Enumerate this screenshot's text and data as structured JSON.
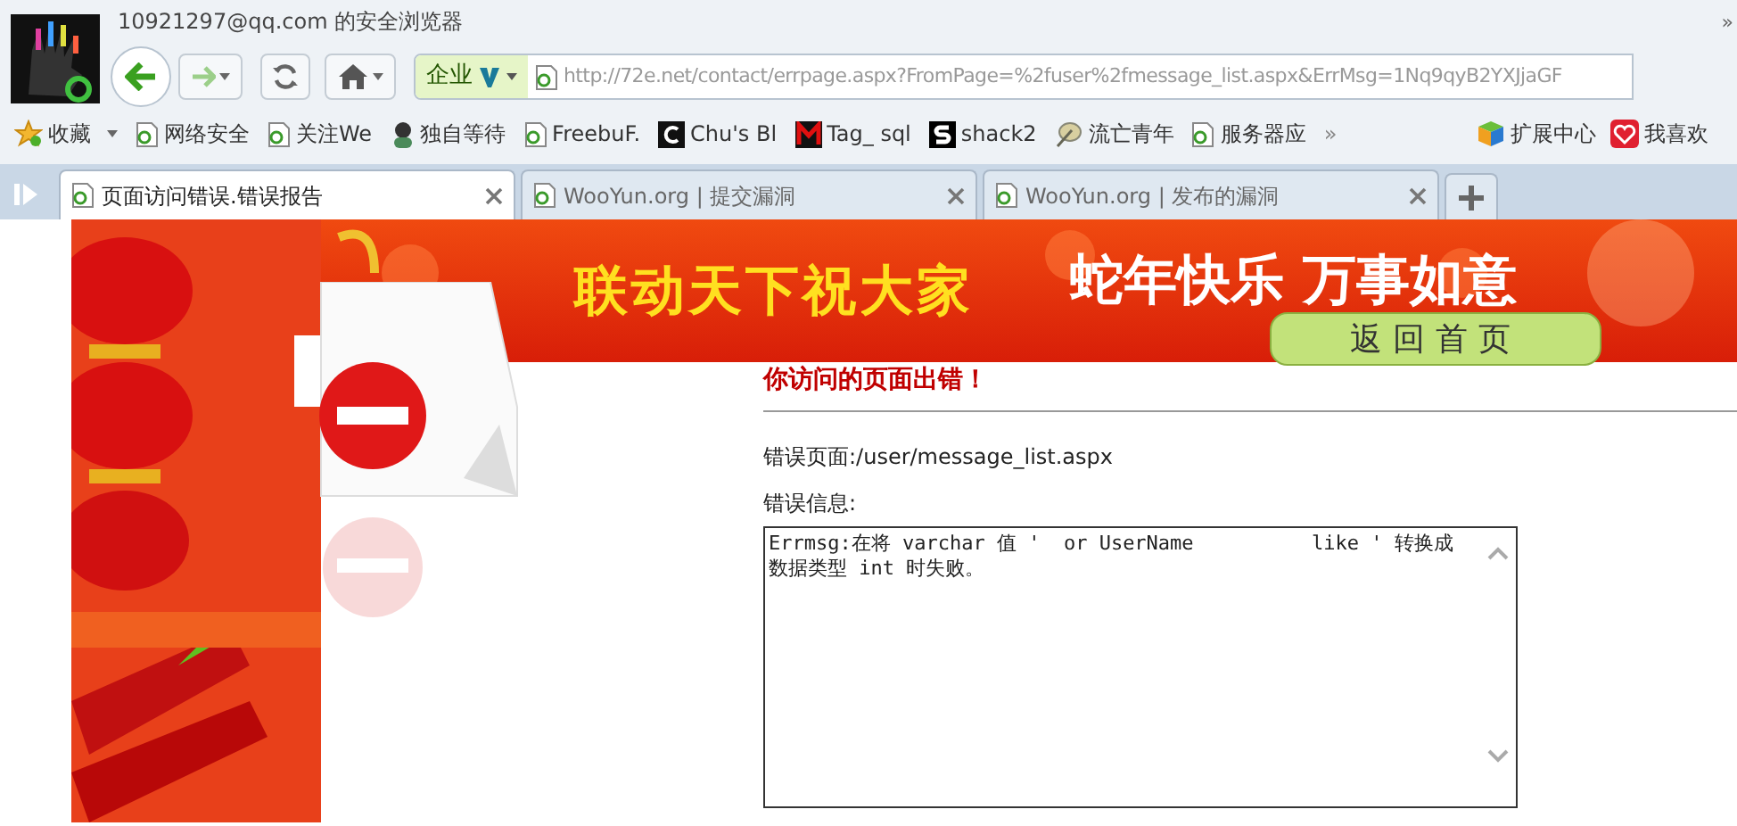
{
  "window": {
    "title": "10921297@qq.com 的安全浏览器"
  },
  "title_bar_chevron": "»",
  "toolbar": {
    "mode_label": "企业",
    "mode_active": true,
    "address": "http://72e.net/contact/errpage.aspx?FromPage=%2fuser%2fmessage_list.aspx&ErrMsg=1Nq9qyB2YXJjaGF"
  },
  "bookmarks": [
    {
      "label": "收藏",
      "kind": "star"
    },
    {
      "label": "网络安全",
      "kind": "page"
    },
    {
      "label": "关注We",
      "kind": "page"
    },
    {
      "label": "独自等待",
      "kind": "avatar"
    },
    {
      "label": "FreebuF.",
      "kind": "page"
    },
    {
      "label": "Chu's Bl",
      "kind": "c"
    },
    {
      "label": "Tag_ sql",
      "kind": "m"
    },
    {
      "label": "shack2",
      "kind": "s"
    },
    {
      "label": "流亡青年",
      "kind": "feather"
    },
    {
      "label": "服务器应",
      "kind": "page"
    }
  ],
  "bookmarks_more": "»",
  "bookmarks_right": [
    {
      "label": "扩展中心",
      "kind": "cube"
    },
    {
      "label": "我喜欢",
      "kind": "heart"
    }
  ],
  "tabs": [
    {
      "label": "页面访问错误.错误报告",
      "selected": true
    },
    {
      "label": "WooYun.org | 提交漏洞",
      "selected": false
    },
    {
      "label": "WooYun.org | 发布的漏洞",
      "selected": false
    }
  ],
  "page": {
    "banner_slogan": "联动天下祝大家",
    "banner_greeting": "蛇年快乐 万事如意",
    "home_button": "返回首页",
    "heading": "你访问的页面出错！",
    "error_page_label": "错误页面:/user/message_list.aspx",
    "error_info_label": "错误信息:",
    "error_message": "Errmsg:在将 varchar 值 '  or UserName          like ' 转换成数据类型 int 时失败。"
  }
}
